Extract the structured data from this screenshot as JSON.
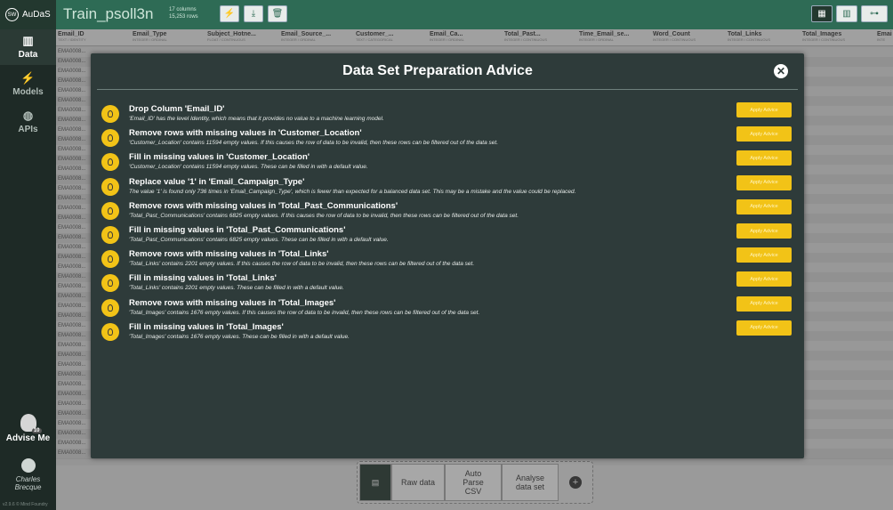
{
  "app": {
    "name": "AuDaS",
    "logo_text": "SW"
  },
  "header": {
    "dataset_title": "Train_psoll3n",
    "meta_line1": "17 columns",
    "meta_line2": "15,253 rows",
    "toolbar": [
      {
        "icon": "lightning-icon",
        "glyph": "⚡"
      },
      {
        "icon": "download-icon",
        "glyph": "⤓"
      },
      {
        "icon": "trash-icon",
        "glyph": "🗑"
      }
    ],
    "views": [
      {
        "icon": "grid-icon",
        "glyph": "▦"
      },
      {
        "icon": "chart-icon",
        "glyph": "▥"
      },
      {
        "icon": "hierarchy-icon",
        "glyph": "⊶"
      }
    ]
  },
  "sidebar": {
    "items": [
      {
        "label": "Data",
        "glyph": "▥",
        "icon": "bar-chart-icon"
      },
      {
        "label": "Models",
        "glyph": "⚡",
        "icon": "lightning-icon"
      },
      {
        "label": "APIs",
        "glyph": "◍",
        "icon": "globe-icon"
      }
    ],
    "advise_label": "Advise Me",
    "advise_badge": "10",
    "user_first": "Charles",
    "user_last": "Brecque",
    "version": "v2.9.6 © Mind Foundry"
  },
  "table": {
    "columns": [
      {
        "name": "Email_ID",
        "type": "TEXT / IDENTITY"
      },
      {
        "name": "Email_Type",
        "type": "INTEGER / ORDINAL"
      },
      {
        "name": "Subject_Hotne...",
        "type": "FLOAT / CONTINUOUS"
      },
      {
        "name": "Email_Source_...",
        "type": "INTEGER / ORDINAL"
      },
      {
        "name": "Customer_...",
        "type": "TEXT / CATEGORICAL"
      },
      {
        "name": "Email_Ca...",
        "type": "INTEGER / ORDINAL"
      },
      {
        "name": "Total_Past...",
        "type": "INTEGER / CONTINUOUS"
      },
      {
        "name": "Time_Email_se...",
        "type": "INTEGER / ORDINAL"
      },
      {
        "name": "Word_Count",
        "type": "INTEGER / CONTINUOUS"
      },
      {
        "name": "Total_Links",
        "type": "INTEGER / CONTINUOUS"
      },
      {
        "name": "Total_Images",
        "type": "INTEGER / CONTINUOUS"
      },
      {
        "name": "Emai",
        "type": "INTE"
      }
    ],
    "row_id_prefix": "EMA0008..."
  },
  "modal": {
    "title": "Data Set Preparation Advice",
    "close_glyph": "✕",
    "apply_label": "Apply Advice",
    "items": [
      {
        "title": "Drop Column 'Email_ID'",
        "desc": "'Email_ID' has the level Identity, which means that it provides no value to a machine learning model."
      },
      {
        "title": "Remove rows with missing values in 'Customer_Location'",
        "desc": "'Customer_Location' contains 11594 empty values. If this causes the row of data to be invalid, then these rows can be filtered out of the data set."
      },
      {
        "title": "Fill in missing values in 'Customer_Location'",
        "desc": "'Customer_Location' contains 11594 empty values. These can be filled in with a default value."
      },
      {
        "title": "Replace value '1' in 'Email_Campaign_Type'",
        "desc": "The value '1' is found only 736 times in 'Email_Campaign_Type', which is fewer than expected for a balanced data set. This may be a mistake and the value could be replaced."
      },
      {
        "title": "Remove rows with missing values in 'Total_Past_Communications'",
        "desc": "'Total_Past_Communications' contains 6825 empty values. If this causes the row of data to be invalid, then these rows can be filtered out of the data set."
      },
      {
        "title": "Fill in missing values in 'Total_Past_Communications'",
        "desc": "'Total_Past_Communications' contains 6825 empty values. These can be filled in with a default value."
      },
      {
        "title": "Remove rows with missing values in 'Total_Links'",
        "desc": "'Total_Links' contains 2201 empty values. If this causes the row of data to be invalid, then these rows can be filtered out of the data set."
      },
      {
        "title": "Fill in missing values in 'Total_Links'",
        "desc": "'Total_Links' contains 2201 empty values. These can be filled in with a default value."
      },
      {
        "title": "Remove rows with missing values in 'Total_Images'",
        "desc": "'Total_Images' contains 1676 empty values. If this causes the row of data to be invalid, then these rows can be filtered out of the data set."
      },
      {
        "title": "Fill in missing values in 'Total_Images'",
        "desc": "'Total_Images' contains 1676 empty values. These can be filled in with a default value."
      }
    ]
  },
  "workflow": {
    "steps": [
      {
        "label": "",
        "icon": "document-icon",
        "glyph": "▤"
      },
      {
        "label": "Raw data"
      },
      {
        "label": "Auto Parse CSV"
      },
      {
        "label": "Analyse data set"
      }
    ],
    "add_glyph": "+"
  }
}
